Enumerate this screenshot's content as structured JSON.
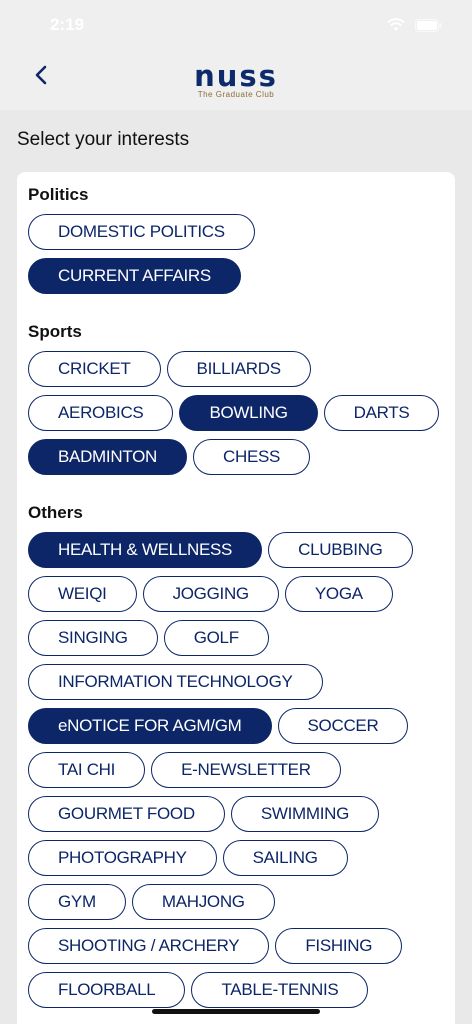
{
  "status": {
    "time": "2:19"
  },
  "header": {
    "logo_text": "nuss",
    "logo_subtitle": "The Graduate Club"
  },
  "page": {
    "title": "Select your interests"
  },
  "colors": {
    "accent": "#0d2668",
    "logo_gold": "#8a6d3b"
  },
  "sections": [
    {
      "title": "Politics",
      "chips": [
        {
          "label": "DOMESTIC POLITICS",
          "selected": false
        },
        {
          "label": "CURRENT AFFAIRS",
          "selected": true
        }
      ]
    },
    {
      "title": "Sports",
      "chips": [
        {
          "label": "CRICKET",
          "selected": false
        },
        {
          "label": "BILLIARDS",
          "selected": false
        },
        {
          "label": "AEROBICS",
          "selected": false
        },
        {
          "label": "BOWLING",
          "selected": true
        },
        {
          "label": "DARTS",
          "selected": false
        },
        {
          "label": "BADMINTON",
          "selected": true
        },
        {
          "label": "CHESS",
          "selected": false
        }
      ]
    },
    {
      "title": "Others",
      "chips": [
        {
          "label": "HEALTH & WELLNESS",
          "selected": true
        },
        {
          "label": "CLUBBING",
          "selected": false
        },
        {
          "label": "WEIQI",
          "selected": false
        },
        {
          "label": "JOGGING",
          "selected": false
        },
        {
          "label": "YOGA",
          "selected": false
        },
        {
          "label": "SINGING",
          "selected": false
        },
        {
          "label": "GOLF",
          "selected": false
        },
        {
          "label": "INFORMATION TECHNOLOGY",
          "selected": false
        },
        {
          "label": "eNOTICE FOR AGM/GM",
          "selected": true
        },
        {
          "label": "SOCCER",
          "selected": false
        },
        {
          "label": "TAI CHI",
          "selected": false
        },
        {
          "label": "E-NEWSLETTER",
          "selected": false
        },
        {
          "label": "GOURMET FOOD",
          "selected": false
        },
        {
          "label": "SWIMMING",
          "selected": false
        },
        {
          "label": "PHOTOGRAPHY",
          "selected": false
        },
        {
          "label": "SAILING",
          "selected": false
        },
        {
          "label": "GYM",
          "selected": false
        },
        {
          "label": "MAHJONG",
          "selected": false
        },
        {
          "label": "SHOOTING / ARCHERY",
          "selected": false
        },
        {
          "label": "FISHING",
          "selected": false
        },
        {
          "label": "FLOORBALL",
          "selected": false
        },
        {
          "label": "TABLE-TENNIS",
          "selected": false
        }
      ]
    }
  ]
}
